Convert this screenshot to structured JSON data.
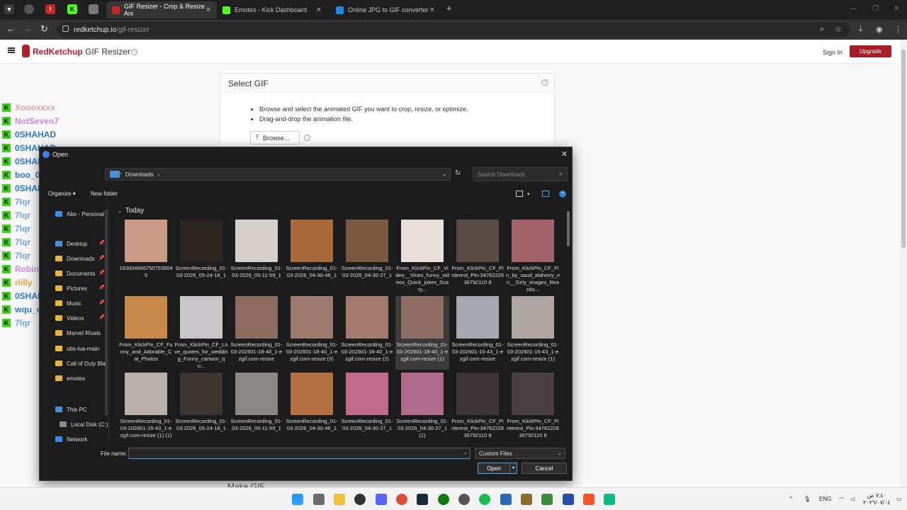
{
  "browser": {
    "tabs": [
      {
        "label": "GIF Resizer - Crop & Resize Ani",
        "color": "#c62828",
        "active": true
      },
      {
        "label": "Emotes - Kick Dashboard",
        "color": "#53fc18",
        "active": false
      },
      {
        "label": "Online JPG to GIF converter",
        "color": "#1e88e5",
        "active": false
      }
    ],
    "new_tab": "+",
    "url_host": "redketchup.io",
    "url_path": "/gif-resizer"
  },
  "site": {
    "brand": "RedKetchup",
    "section": "GIF Resizer",
    "signin": "Sign In",
    "upgrade": "Upgrade",
    "brand_color": "#b31e2b"
  },
  "card": {
    "title": "Select GIF",
    "bullets": [
      "Browse and select the animated GIF you want to crop, resize, or optimize.",
      "Drag-and-drop the animation file."
    ],
    "browse_label": "Browse...",
    "make_gif": "Make GIF"
  },
  "chat": [
    {
      "name": "Xoooxxxx",
      "msg": "",
      "color": "#d7a5a5"
    },
    {
      "name": "NotSeven7",
      "msg": "",
      "color": "#cf8ad8"
    },
    {
      "name": "0SHAHAD",
      "msg": "",
      "color": "#2a79c9"
    },
    {
      "name": "0SHAHAD",
      "msg": "",
      "color": "#2a79c9"
    },
    {
      "name": "0SHAHAD",
      "msg": "",
      "color": "#2a79c9"
    },
    {
      "name": "boo_09",
      "msg": "",
      "color": "#2a79c9"
    },
    {
      "name": "0SHAHAD",
      "msg": "",
      "color": "#2a79c9"
    },
    {
      "name": "7lqr",
      "msg": "",
      "color": "#6fa4e8"
    },
    {
      "name": "7lqr",
      "msg": "",
      "color": "#6fa4e8"
    },
    {
      "name": "7lqr",
      "msg": "",
      "color": "#6fa4e8"
    },
    {
      "name": "7lqr",
      "msg": "",
      "color": "#6fa4e8"
    },
    {
      "name": "7lqr",
      "msg": "",
      "color": "#6fa4e8"
    },
    {
      "name": "Robin_q64",
      "msg": "",
      "color": "#cf8ad8"
    },
    {
      "name": "rlilly",
      "msg": "",
      "color": "#e3a33a"
    },
    {
      "name": "0SHAHAD",
      "msg": "",
      "color": "#2a79c9"
    },
    {
      "name": "wqu_op",
      "msg": "",
      "color": "#2a79c9"
    },
    {
      "name": "7lqr",
      "msg": "",
      "color": "#6fa4e8"
    }
  ],
  "dialog": {
    "title": "Open",
    "path": "Downloads",
    "search_placeholder": "Search Downloads",
    "organize": "Organize",
    "new_folder": "New folder",
    "group": "Today",
    "nav": [
      {
        "label": "Abo - Personal",
        "pinned": false
      },
      {
        "label": "Desktop",
        "pinned": true
      },
      {
        "label": "Downloads",
        "pinned": true
      },
      {
        "label": "Documents",
        "pinned": true
      },
      {
        "label": "Pictures",
        "pinned": true
      },
      {
        "label": "Music",
        "pinned": true
      },
      {
        "label": "Videos",
        "pinned": true
      },
      {
        "label": "Marvel Rivals",
        "pinned": false
      },
      {
        "label": "obs-lua-main",
        "pinned": false
      },
      {
        "label": "Call of Duty Bla",
        "pinned": false
      },
      {
        "label": "emotes",
        "pinned": false
      },
      {
        "label": "This PC",
        "pinned": false
      },
      {
        "label": "Local Disk (C:)",
        "pinned": false
      },
      {
        "label": "Network",
        "pinned": false
      }
    ],
    "files": [
      {
        "name": "1630046667507539045",
        "color": "#c99a86"
      },
      {
        "name": "ScreenRecording_01-03-2026_05-24-18_1",
        "color": "#2c2420"
      },
      {
        "name": "ScreenRecording_01-03-2026_05-11-59_1",
        "color": "#d4cfca"
      },
      {
        "name": "ScreenRecording_01-03-2026_04-30-46_1",
        "color": "#a86a3c"
      },
      {
        "name": "ScreenRecording_01-03-2026_04-30-27_1",
        "color": "#7b5a44"
      },
      {
        "name": "From_KlickPin_CF_Video__Vines_funny_videos_Quick_jokes_Scary...",
        "color": "#e9e0dc"
      },
      {
        "name": "From_KlickPin_CF_Pinterest_Pin-3476222836792110 8",
        "color": "#5a4c44"
      },
      {
        "name": "From_KlickPin_CF_Pin_by_saud_alahmry_on__Girly_images_Reactio...",
        "color": "#a4626b"
      },
      {
        "name": "From_KlickPin_CF_Funny_and_Adorable_Cat_Photos",
        "color": "#c88a4a"
      },
      {
        "name": "From_KlickPin_CF_Love_quotes_for_wedding_Funny_cartoon_qu...",
        "color": "#c9c6c9"
      },
      {
        "name": "ScreenRecording_01-03-202601-18-40_1-ezgif.com-resize",
        "color": "#8c6c60"
      },
      {
        "name": "ScreenRecording_01-03-202601-18-40_1-ezgif.com-resize (3)",
        "color": "#9c7a70"
      },
      {
        "name": "ScreenRecording_01-03-202601-18-40_1-ezgif.com-resize (2)",
        "color": "#a47a6c"
      },
      {
        "name": "ScreenRecording_01-03-202601-18-40_1-ezgif.com-resize (1)",
        "color": "#8e6e64"
      },
      {
        "name": "ScreenRecording_01-03-202601-15-43_1-ezgif.com-resize",
        "color": "#a8a8b0"
      },
      {
        "name": "ScreenRecording_01-03-202601-15-43_1-ezgif.com-resize (1)",
        "color": "#b0a6a2"
      },
      {
        "name": "ScreenRecording_01-03-202601-15-43_1-ezgif.com-resize (1) (1)",
        "color": "#b8aeaa"
      },
      {
        "name": "ScreenRecording_01-03-2026_05-24-18_1",
        "color": "#3c3430"
      },
      {
        "name": "ScreenRecording_01-03-2026_05-11-59_1",
        "color": "#8a8784"
      },
      {
        "name": "ScreenRecording_01-03-2026_04-30-46_1",
        "color": "#b27042"
      },
      {
        "name": "ScreenRecording_01-03-2026_04-30-27_1",
        "color": "#c06a8a"
      },
      {
        "name": "ScreenRecording_01-03-2026_04-30-27_1 (1)",
        "color": "#b06a8a"
      },
      {
        "name": "From_KlickPin_CF_Pinterest_Pin-3476222836792110 8",
        "color": "#3c3436"
      },
      {
        "name": "From_KlickPin_CF_Pinterest_Pin-3476222836792110 8",
        "color": "#484042"
      }
    ],
    "file_name_label": "File name:",
    "file_name_value": "",
    "file_type": "Custom Files",
    "open": "Open",
    "cancel": "Cancel"
  },
  "taskbar": {
    "lang": "ENG",
    "time": "٧:٤٠ ص",
    "date": "٢٠٢٦/٠٧/٠٤"
  }
}
